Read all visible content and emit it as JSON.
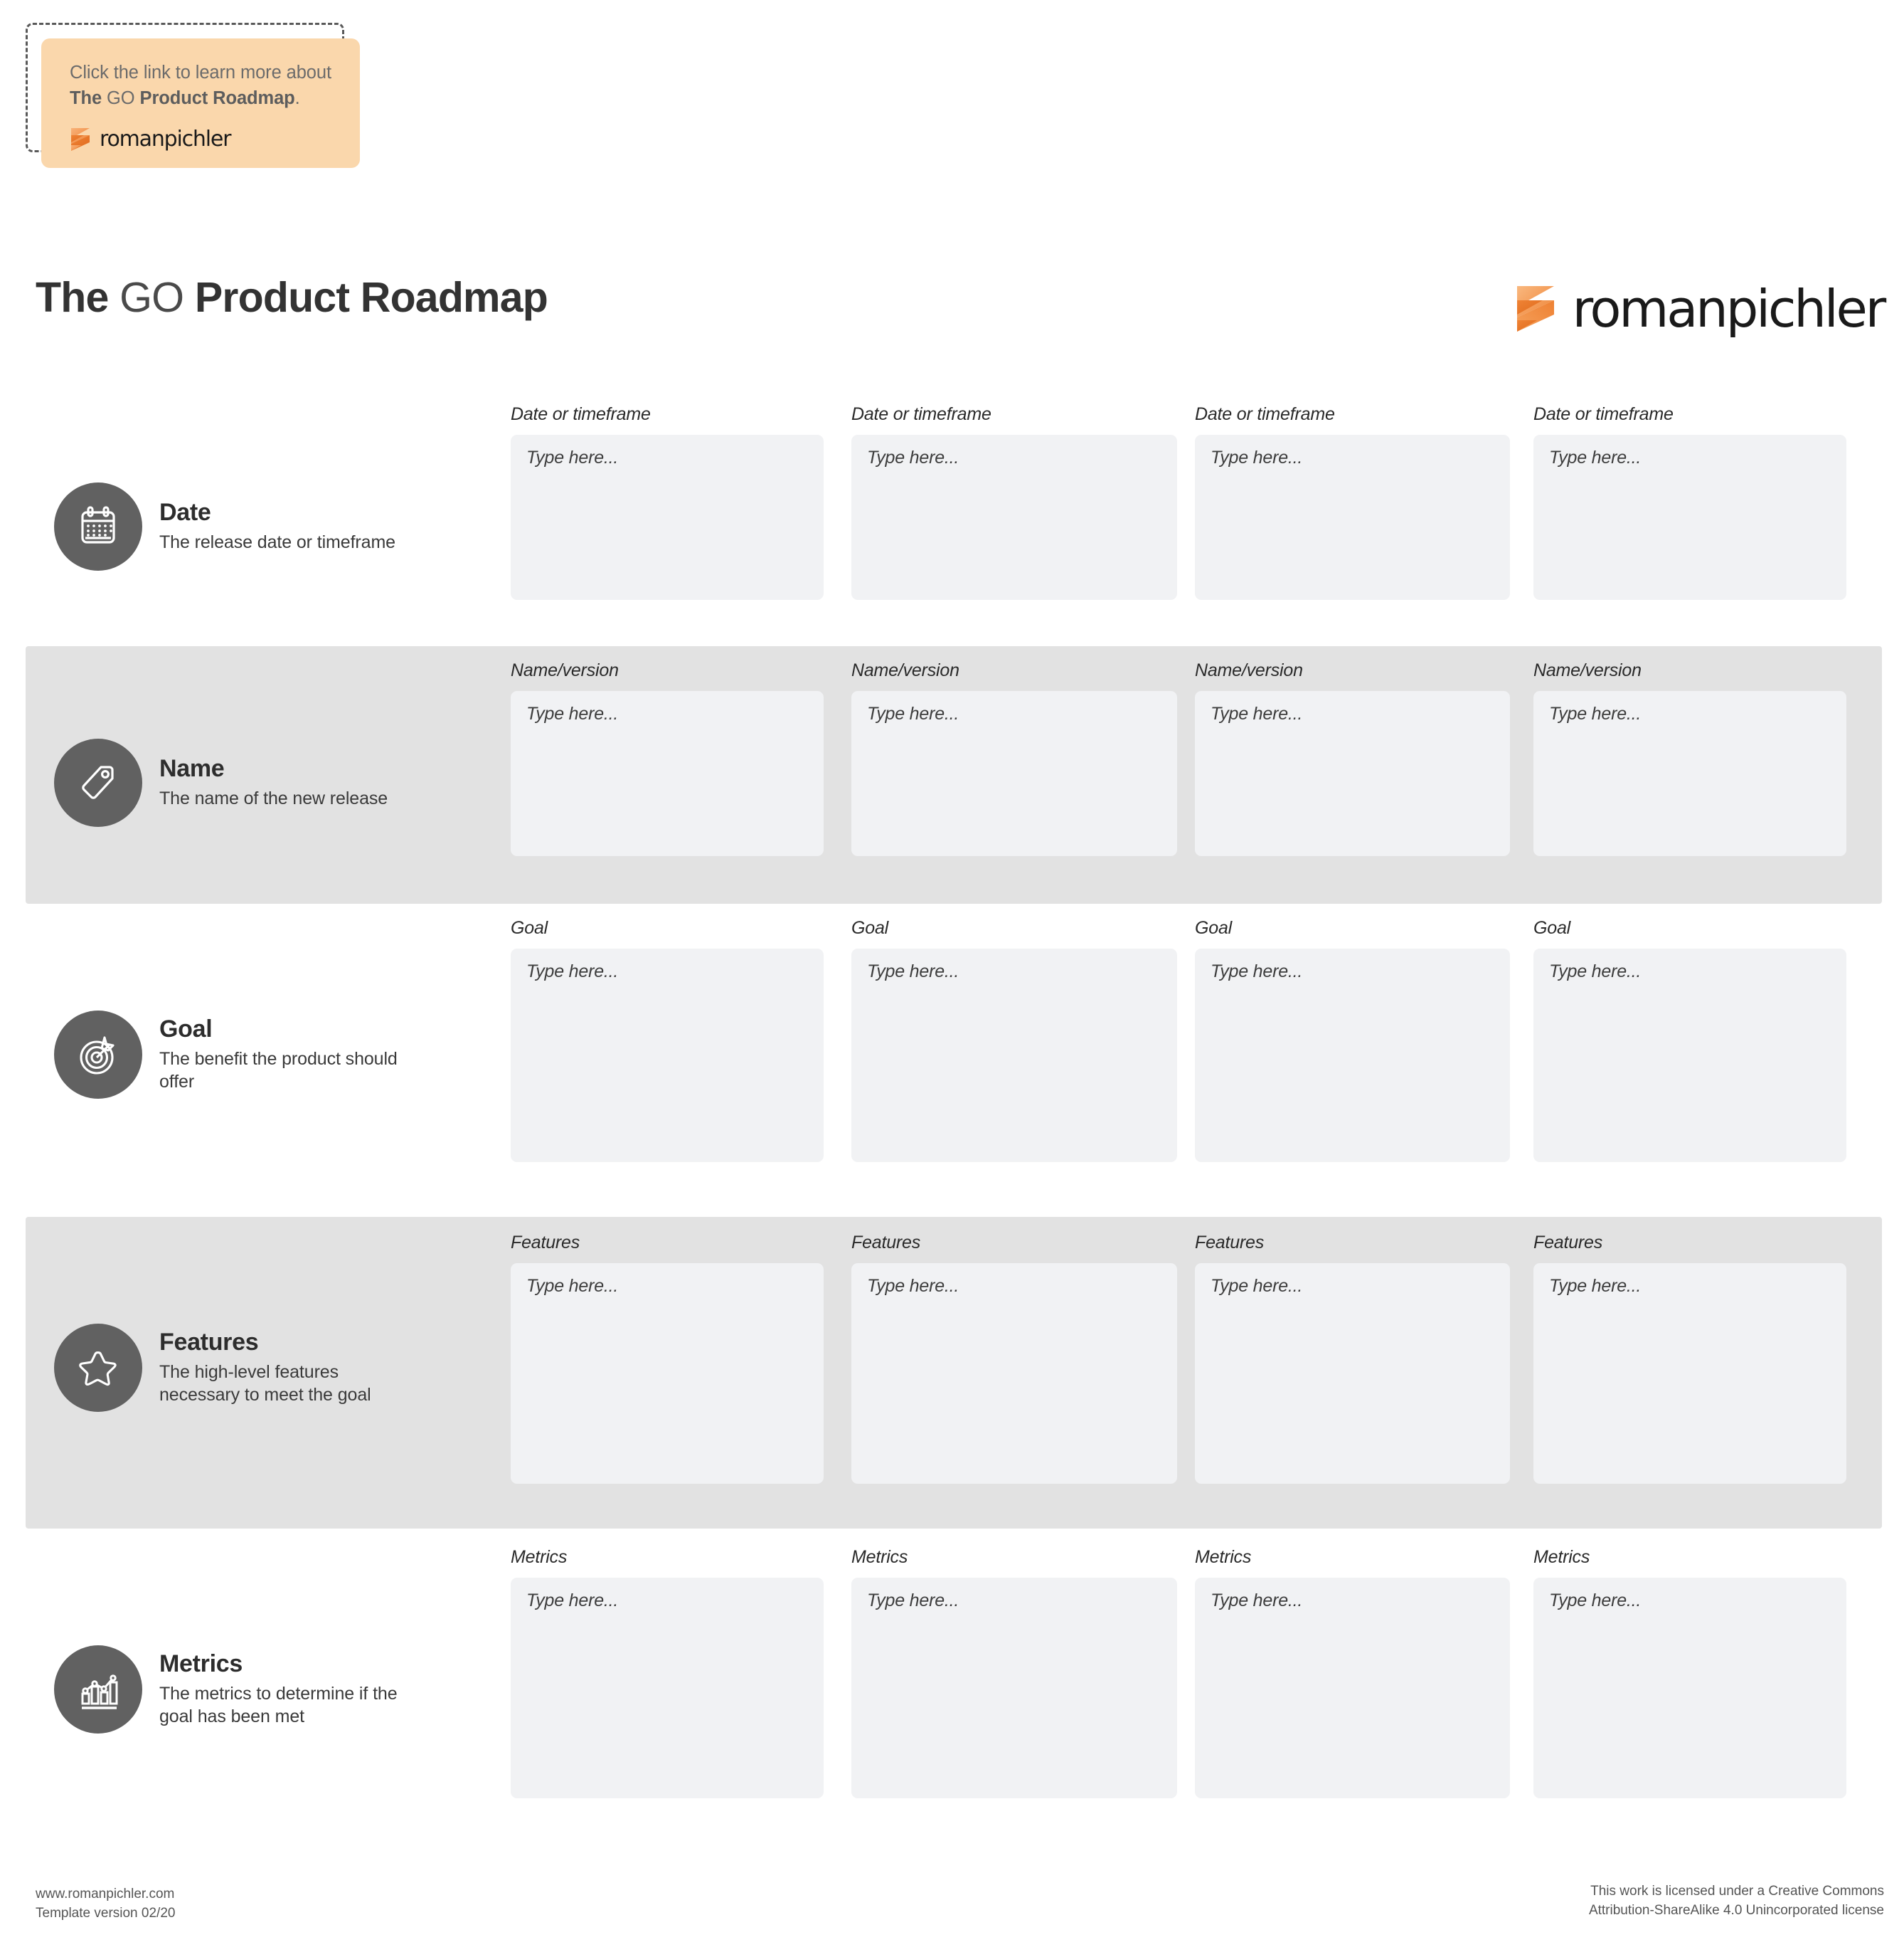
{
  "sticky_note": {
    "line1": "Click the link to learn more about",
    "line2_bold_a": "The",
    "line2_go": "GO",
    "line2_bold_b": "Product Roadmap",
    "line2_period": ".",
    "logo_wordmark": "romanpichler"
  },
  "header": {
    "title_a": "The",
    "title_go": "GO",
    "title_b": "Product Roadmap",
    "logo_wordmark": "romanpichler"
  },
  "columns": [
    {
      "index": 1
    },
    {
      "index": 2
    },
    {
      "index": 3
    },
    {
      "index": 4
    }
  ],
  "placeholder": "Type here...",
  "rows": [
    {
      "key": "date",
      "icon": "calendar-icon",
      "title": "Date",
      "desc": "The release date or timeframe",
      "cell_label": "Date or timeframe",
      "banded": false,
      "cells": [
        "",
        "",
        "",
        ""
      ]
    },
    {
      "key": "name",
      "icon": "tag-icon",
      "title": "Name",
      "desc": "The name of the new release",
      "cell_label": "Name/version",
      "banded": true,
      "cells": [
        "",
        "",
        "",
        ""
      ]
    },
    {
      "key": "goal",
      "icon": "target-icon",
      "title": "Goal",
      "desc": "The benefit the product should offer",
      "cell_label": "Goal",
      "banded": false,
      "cells": [
        "",
        "",
        "",
        ""
      ]
    },
    {
      "key": "features",
      "icon": "star-icon",
      "title": "Features",
      "desc": "The high-level features necessary to meet the goal",
      "cell_label": "Features",
      "banded": true,
      "cells": [
        "",
        "",
        "",
        ""
      ]
    },
    {
      "key": "metrics",
      "icon": "bar-chart-trend-icon",
      "title": "Metrics",
      "desc": "The metrics to determine if the goal has been met",
      "cell_label": "Metrics",
      "banded": false,
      "cells": [
        "",
        "",
        "",
        ""
      ]
    }
  ],
  "footer": {
    "website": "www.romanpichler.com",
    "version": "Template version 02/20",
    "license_line1": "This work is licensed under a Creative Commons",
    "license_line2": "Attribution-ShareAlike 4.0 Unincorporated license"
  },
  "colors": {
    "brand_orange": "#f08a3c",
    "brand_orange_dark": "#e8722a",
    "band_gray": "#e2e2e2",
    "field_gray": "#f1f2f4",
    "icon_circle": "#616161",
    "sticky_bg": "#fad7ac"
  }
}
